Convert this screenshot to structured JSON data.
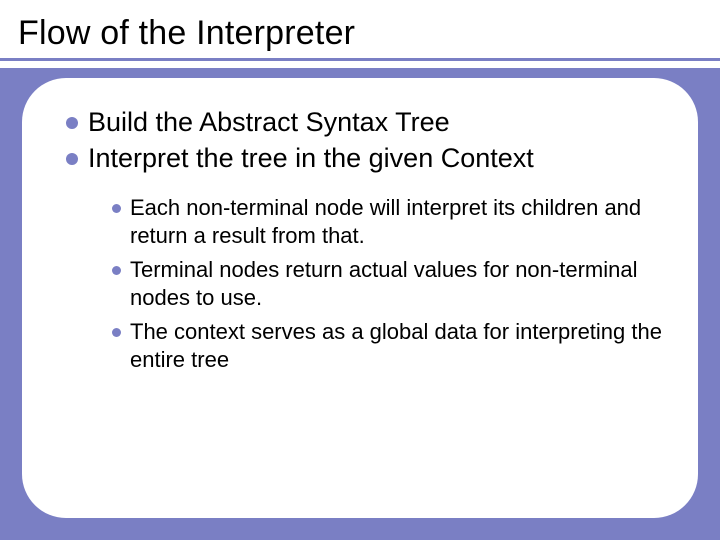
{
  "title": "Flow of the Interpreter",
  "main_items": [
    "Build the Abstract Syntax Tree",
    "Interpret the tree in the given Context"
  ],
  "sub_items": [
    "Each non-terminal node will interpret its children and return a result from that.",
    "Terminal nodes return actual values for non-terminal nodes to use.",
    "The context serves as a global data for interpreting the entire tree"
  ]
}
